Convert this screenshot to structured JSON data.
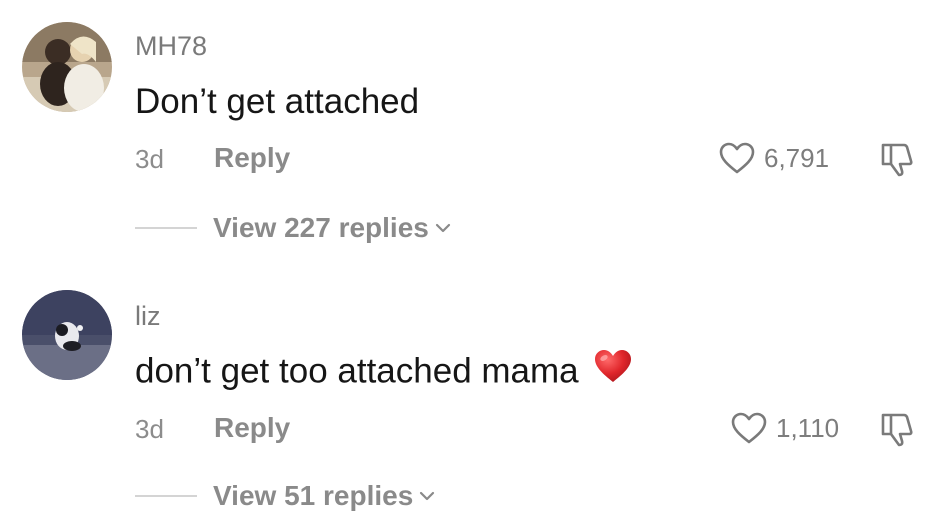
{
  "comments": [
    {
      "username": "MH78",
      "text": "Don’t get attached",
      "emoji": "",
      "time": "3d",
      "reply_label": "Reply",
      "like_count": "6,791",
      "view_replies_label": "View 227 replies",
      "avatar_icon": "avatar-photo"
    },
    {
      "username": "liz",
      "text": "don’t get too attached mama",
      "emoji": "red-heart",
      "time": "3d",
      "reply_label": "Reply",
      "like_count": "1,110",
      "view_replies_label": "View 51 replies",
      "avatar_icon": "avatar-photo"
    }
  ],
  "icons": {
    "like": "heart-outline-icon",
    "dislike": "thumbs-down-icon",
    "expand": "chevron-down-icon"
  },
  "colors": {
    "primary_text": "#161616",
    "secondary_text": "#8a8a8a",
    "emoji_heart": "#e0262b"
  }
}
